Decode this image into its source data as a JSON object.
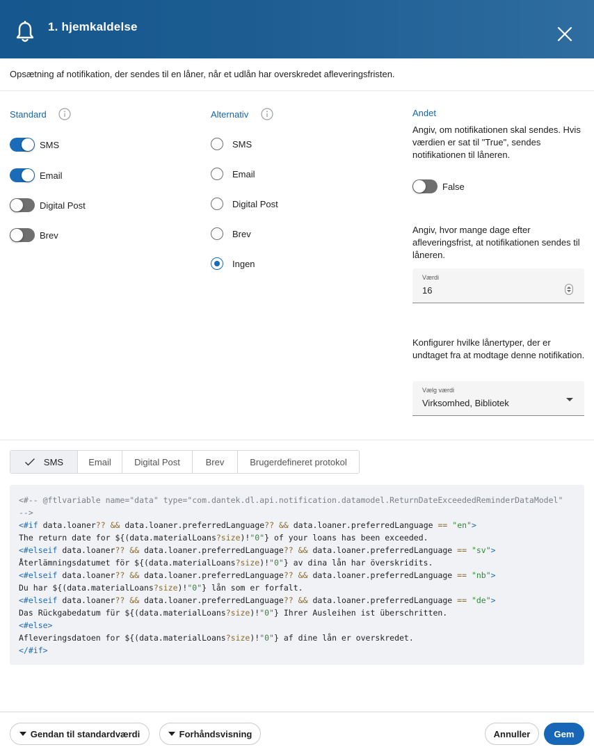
{
  "header": {
    "title": "1. hjemkaldelse",
    "icon": "bell-icon",
    "close_icon": "close-icon"
  },
  "description": "Opsætning af notifikation, der sendes til en låner, når et udlån har overskredet afleveringsfristen.",
  "standard": {
    "title": "Standard",
    "toggles": [
      {
        "label": "SMS",
        "on": true
      },
      {
        "label": "Email",
        "on": true
      },
      {
        "label": "Digital Post",
        "on": false
      },
      {
        "label": "Brev",
        "on": false
      }
    ]
  },
  "alternativ": {
    "title": "Alternativ",
    "options": [
      {
        "label": "SMS",
        "checked": false
      },
      {
        "label": "Email",
        "checked": false
      },
      {
        "label": "Digital Post",
        "checked": false
      },
      {
        "label": "Brev",
        "checked": false
      },
      {
        "label": "Ingen",
        "checked": true
      }
    ]
  },
  "andet": {
    "title": "Andet",
    "send_text": "Angiv, om notifikationen skal sendes. Hvis værdien er sat til \"True\", sendes notifikationen til låneren.",
    "send_toggle": {
      "label": "False",
      "on": false
    },
    "days_text": "Angiv, hvor mange dage efter afleveringsfrist, at notifikationen sendes til låneren.",
    "days_field": {
      "label": "Værdi",
      "value": "16"
    },
    "exempt_text": "Konfigurer hvilke lånertyper, der er undtaget fra at modtage denne notifikation.",
    "exempt_select": {
      "label": "Vælg værdi",
      "value": "Virksomhed, Bibliotek"
    }
  },
  "tabs": [
    {
      "label": "SMS",
      "active": true
    },
    {
      "label": "Email",
      "active": false
    },
    {
      "label": "Digital Post",
      "active": false
    },
    {
      "label": "Brev",
      "active": false
    },
    {
      "label": "Brugerdefineret protokol",
      "active": false
    }
  ],
  "code_lines": [
    "<#-- @ftlvariable name=\"data\" type=\"com.dantek.dl.api.notification.datamodel.ReturnDateExceededReminderDataModel\"",
    "-->",
    "<#if data.loaner?? && data.loaner.preferredLanguage?? && data.loaner.preferredLanguage == \"en\">",
    "The return date for ${(data.materialLoans?size)!\"0\"} of your loans has been exceeded.",
    "<#elseif data.loaner?? && data.loaner.preferredLanguage?? && data.loaner.preferredLanguage == \"sv\">",
    "Återlämningsdatumet för ${(data.materialLoans?size)!\"0\"} av dina lån har överskridits.",
    "<#elseif data.loaner?? && data.loaner.preferredLanguage?? && data.loaner.preferredLanguage == \"nb\">",
    "Du har ${(data.materialLoans?size)!\"0\"} lån som er forfalt.",
    "<#elseif data.loaner?? && data.loaner.preferredLanguage?? && data.loaner.preferredLanguage == \"de\">",
    "Das Rückgabedatum für ${(data.materialLoans?size)!\"0\"} Ihrer Ausleihen ist überschritten.",
    "<#else>",
    "Afleveringsdatoen for ${(data.materialLoans?size)!\"0\"} af dine lån er overskredet.",
    "</#if>"
  ],
  "footer": {
    "reset_label": "Gendan til standardværdi",
    "preview_label": "Forhåndsvisning",
    "cancel_label": "Annuller",
    "save_label": "Gem"
  },
  "colors": {
    "accent": "#1a6cb8",
    "header": "#1d5d91"
  }
}
